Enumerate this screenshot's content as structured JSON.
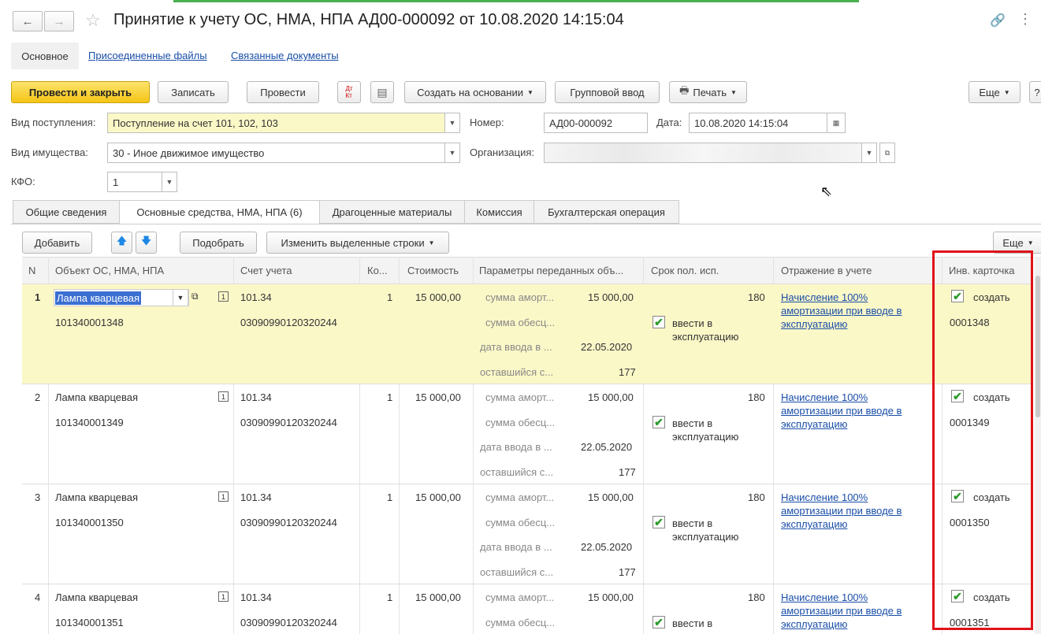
{
  "window": {
    "title": "Принятие к учету ОС, НМА, НПА АД00-000092 от 10.08.2020 14:15:04"
  },
  "sections": {
    "main": "Основное",
    "files": "Присоединенные файлы",
    "docs": "Связанные документы"
  },
  "toolbar": {
    "post_close": "Провести и закрыть",
    "save": "Записать",
    "post": "Провести",
    "create_based": "Создать на основании",
    "group_input": "Групповой ввод",
    "print": "Печать",
    "more": "Еще"
  },
  "form": {
    "receipt_type_label": "Вид поступления:",
    "receipt_type_value": "Поступление на счет 101, 102, 103",
    "number_label": "Номер:",
    "number_value": "АД00-000092",
    "date_label": "Дата:",
    "date_value": "10.08.2020 14:15:04",
    "property_type_label": "Вид имущества:",
    "property_type_value": "30 - Иное движимое имущество",
    "org_label": "Организация:",
    "kfo_label": "КФО:",
    "kfo_value": "1"
  },
  "tabs": [
    {
      "label": "Общие сведения"
    },
    {
      "label": "Основные средства, НМА, НПА (6)"
    },
    {
      "label": "Драгоценные материалы"
    },
    {
      "label": "Комиссия"
    },
    {
      "label": "Бухгалтерская операция"
    }
  ],
  "table_toolbar": {
    "add": "Добавить",
    "pick": "Подобрать",
    "change_rows": "Изменить выделенные строки",
    "more": "Еще"
  },
  "table": {
    "headers": {
      "n": "N",
      "object": "Объект ОС, НМА, НПА",
      "account": "Счет учета",
      "qty": "Ко...",
      "cost": "Стоимость",
      "params": "Параметры переданных объ...",
      "term": "Срок пол. исп.",
      "reflection": "Отражение в учете",
      "card": "Инв. карточка"
    },
    "param_labels": {
      "amort": "сумма аморт...",
      "wear": "сумма обесц...",
      "date": "дата ввода в ...",
      "remain": "оставшийся с..."
    },
    "rows": [
      {
        "n": "1",
        "name": "Лампа кварцевая",
        "inv": "101340001348",
        "account": "101.34",
        "kbk": "03090990120320244",
        "qty": "1",
        "cost": "15 000,00",
        "amort": "15 000,00",
        "date": "22.05.2020",
        "remain": "177",
        "term": "180",
        "commission": "ввести в эксплуатацию",
        "reflection": "Начисление 100% амортизации при вводе в эксплуатацию",
        "card_action": "создать",
        "card_num": "0001348"
      },
      {
        "n": "2",
        "name": "Лампа кварцевая",
        "inv": "101340001349",
        "account": "101.34",
        "kbk": "03090990120320244",
        "qty": "1",
        "cost": "15 000,00",
        "amort": "15 000,00",
        "date": "22.05.2020",
        "remain": "177",
        "term": "180",
        "commission": "ввести в эксплуатацию",
        "reflection": "Начисление 100% амортизации при вводе в эксплуатацию",
        "card_action": "создать",
        "card_num": "0001349"
      },
      {
        "n": "3",
        "name": "Лампа кварцевая",
        "inv": "101340001350",
        "account": "101.34",
        "kbk": "03090990120320244",
        "qty": "1",
        "cost": "15 000,00",
        "amort": "15 000,00",
        "date": "22.05.2020",
        "remain": "177",
        "term": "180",
        "commission": "ввести в эксплуатацию",
        "reflection": "Начисление 100% амортизации при вводе в эксплуатацию",
        "card_action": "создать",
        "card_num": "0001350"
      },
      {
        "n": "4",
        "name": "Лампа кварцевая",
        "inv": "101340001351",
        "account": "101.34",
        "kbk": "03090990120320244",
        "qty": "1",
        "cost": "15 000,00",
        "amort": "15 000,00",
        "term": "180",
        "commission": "ввести в эксплуатацию",
        "reflection": "Начисление 100% амортизации при вводе в эксплуатацию",
        "card_action": "создать",
        "card_num": "0001351"
      }
    ]
  },
  "colors": {
    "accent_yellow": "#f5c516",
    "selected_row": "#fbf8c8",
    "link": "#1a4ea8",
    "highlight_red": "#e0121a"
  }
}
